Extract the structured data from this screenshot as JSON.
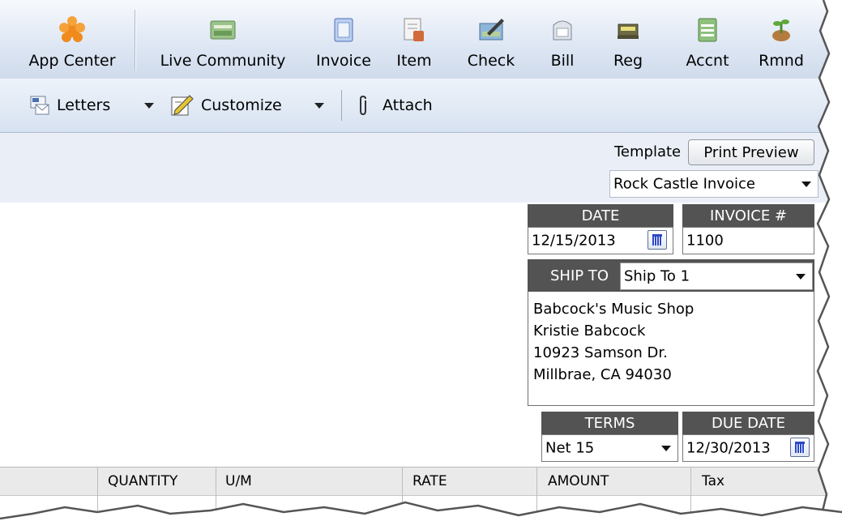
{
  "toolbar": {
    "buttons": [
      {
        "label": "App Center",
        "icon": "app-center-icon"
      },
      {
        "label": "Live Community",
        "icon": "live-community-icon"
      },
      {
        "label": "Invoice",
        "icon": "invoice-icon"
      },
      {
        "label": "Item",
        "icon": "item-icon"
      },
      {
        "label": "Check",
        "icon": "check-icon"
      },
      {
        "label": "Bill",
        "icon": "bill-icon"
      },
      {
        "label": "Reg",
        "icon": "register-icon"
      },
      {
        "label": "Accnt",
        "icon": "account-icon"
      },
      {
        "label": "Rmnd",
        "icon": "reminder-icon"
      }
    ]
  },
  "toolbar2": {
    "letters_label": "Letters",
    "customize_label": "Customize",
    "attach_label": "Attach"
  },
  "form_header": {
    "template_label": "Template",
    "print_preview_label": "Print Preview",
    "template_value": "Rock Castle Invoice"
  },
  "invoice": {
    "date_label": "DATE",
    "date_value": "12/15/2013",
    "invoice_no_label": "INVOICE #",
    "invoice_no_value": "1100",
    "ship_to_label": "SHIP TO",
    "ship_to_value": "Ship To 1",
    "address": [
      "Babcock's Music Shop",
      "Kristie Babcock",
      "10923 Samson Dr.",
      "Millbrae, CA 94030"
    ],
    "terms_label": "TERMS",
    "terms_value": "Net 15",
    "due_date_label": "DUE DATE",
    "due_date_value": "12/30/2013"
  },
  "line_items": {
    "columns": [
      "QUANTITY",
      "U/M",
      "RATE",
      "AMOUNT",
      "Tax"
    ]
  },
  "colors": {
    "header_dark": "#535353",
    "toolbar_blue": "#dde6f3",
    "calendar_blue": "#2a49c8"
  }
}
